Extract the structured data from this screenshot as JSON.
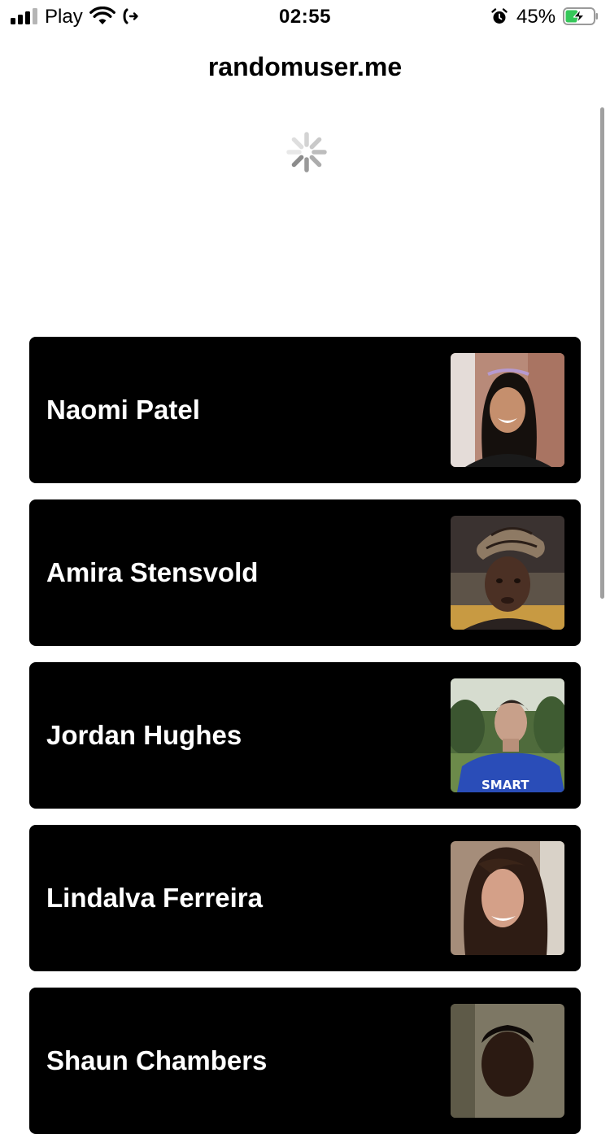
{
  "status_bar": {
    "carrier": "Play",
    "time": "02:55",
    "battery_percent": "45%",
    "signal_bars": 3,
    "signal_bars_total": 4,
    "battery_level": 0.45,
    "battery_color": "#35c759",
    "icons": [
      "signal-icon",
      "wifi-icon",
      "call-forwarding-icon",
      "alarm-icon",
      "battery-charging-icon"
    ]
  },
  "nav": {
    "title": "randomuser.me"
  },
  "loading": {
    "icon": "activity-spinner-icon"
  },
  "users": [
    {
      "name": "Naomi Patel"
    },
    {
      "name": "Amira Stensvold"
    },
    {
      "name": "Jordan Hughes"
    },
    {
      "name": "Lindalva Ferreira"
    },
    {
      "name": "Shaun Chambers"
    }
  ]
}
